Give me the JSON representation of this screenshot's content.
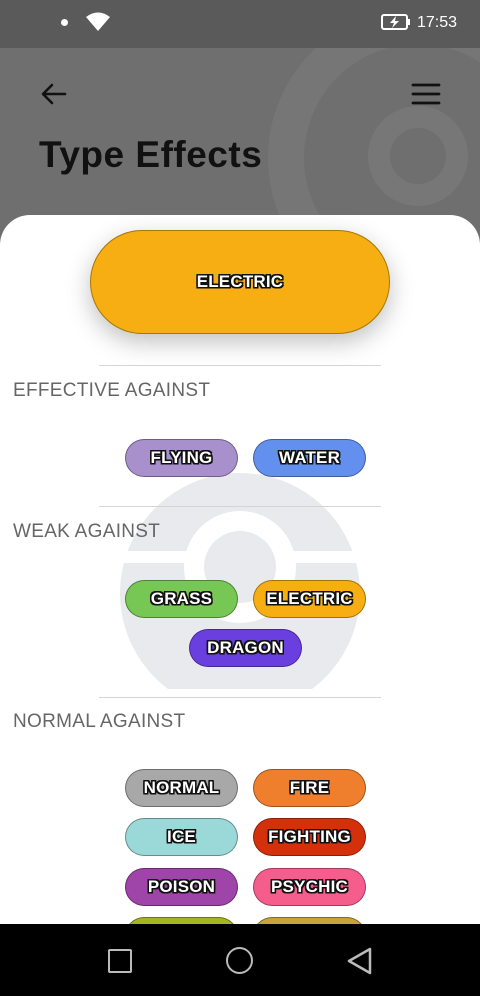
{
  "status_bar": {
    "time": "17:53"
  },
  "header": {
    "title": "Type Effects"
  },
  "main_type": {
    "label": "ELECTRIC",
    "color": "#f6ae12"
  },
  "sections": {
    "effective": {
      "title": "EFFECTIVE AGAINST",
      "types": [
        {
          "label": "FLYING",
          "color": "#a890cc"
        },
        {
          "label": "WATER",
          "color": "#6390ef"
        }
      ]
    },
    "weak": {
      "title": "WEAK AGAINST",
      "types": [
        {
          "label": "GRASS",
          "color": "#77c755"
        },
        {
          "label": "ELECTRIC",
          "color": "#f6ae12"
        },
        {
          "label": "DRAGON",
          "color": "#6a3fe0"
        }
      ]
    },
    "normal": {
      "title": "NORMAL AGAINST",
      "types": [
        {
          "label": "NORMAL",
          "color": "#a8a8a8"
        },
        {
          "label": "FIRE",
          "color": "#ef7f2d"
        },
        {
          "label": "ICE",
          "color": "#9bd8d8"
        },
        {
          "label": "FIGHTING",
          "color": "#d3300b"
        },
        {
          "label": "POISON",
          "color": "#9f44a8"
        },
        {
          "label": "PSYCHIC",
          "color": "#f45d8c"
        }
      ]
    }
  }
}
